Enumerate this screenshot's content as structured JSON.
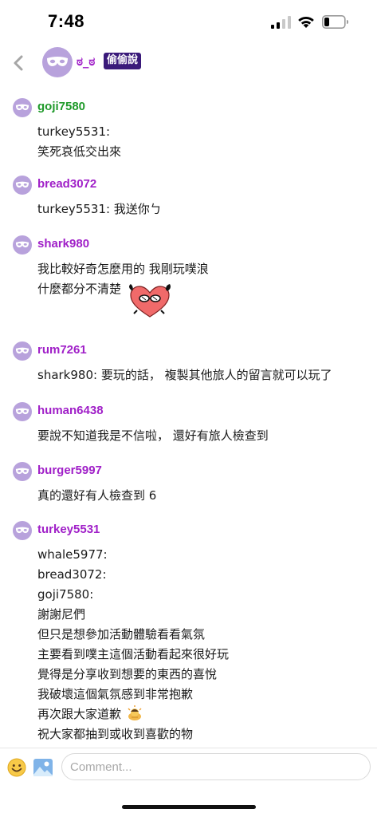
{
  "status_bar": {
    "time": "7:48"
  },
  "header": {
    "name": "ಠ_ಠ",
    "badge": "偷偷說"
  },
  "messages": [
    {
      "author": "goji7580",
      "author_color": "#1f9a2a",
      "lines": [
        "turkey5531:",
        "笑死哀低交出來"
      ]
    },
    {
      "author": "bread3072",
      "author_color": "#a020c8",
      "lines": [
        "turkey5531: 我送你ㄅ"
      ]
    },
    {
      "author": "shark980",
      "author_color": "#a020c8",
      "lines": [
        "我比較好奇怎麼用的 我剛玩噗浪",
        "什麼都分不清楚"
      ],
      "sticker": "heart-glasses-sticker"
    },
    {
      "author": "rum7261",
      "author_color": "#a020c8",
      "lines": [
        "shark980: 要玩的話， 複製其他旅人的留言就可以玩了"
      ]
    },
    {
      "author": "human6438",
      "author_color": "#a020c8",
      "lines": [
        "要說不知道我是不信啦， 還好有旅人檢查到"
      ]
    },
    {
      "author": "burger5997",
      "author_color": "#a020c8",
      "lines": [
        "真的還好有人檢查到 6"
      ]
    },
    {
      "author": "turkey5531",
      "author_color": "#a020c8",
      "lines": [
        "whale5977:",
        "bread3072:",
        "goji7580:",
        "謝謝尼們",
        "但只是想參加活動體驗看看氣氛",
        "主要看到噗主這個活動看起來很好玩",
        "覺得是分享收到想要的東西的喜悅",
        "我破壞這個氣氛感到非常抱歉",
        "再次跟大家道歉",
        "祝大家都抽到或收到喜歡的物"
      ],
      "inline_emoji_line": 8
    }
  ],
  "composer": {
    "placeholder": "Comment..."
  },
  "colors": {
    "avatar": "#b8a2dc",
    "author": "#a020c8",
    "author_alt": "#1f9a2a",
    "badge_bg": "#3a1a7a"
  },
  "icons": [
    "back-chevron-icon",
    "mask-avatar-icon",
    "smiley-icon",
    "image-icon",
    "signal-icon",
    "wifi-icon",
    "battery-icon"
  ]
}
